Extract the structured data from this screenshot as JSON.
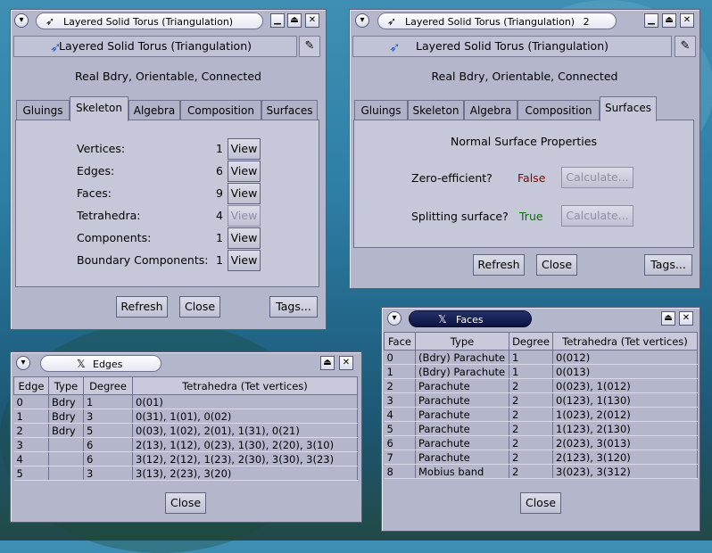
{
  "colors": {
    "false_color": "#8b0000",
    "true_color": "#0e6c0e",
    "accent": "#2a63c9"
  },
  "win1": {
    "title": "Layered Solid Torus (Triangulation)",
    "header": "Layered Solid Torus (Triangulation)",
    "status": "Real Bdry, Orientable, Connected",
    "tabs": [
      "Gluings",
      "Skeleton",
      "Algebra",
      "Composition",
      "Surfaces"
    ],
    "active_tab": "Skeleton",
    "rows": [
      {
        "label": "Vertices:",
        "count": "1",
        "button": "View",
        "enabled": true
      },
      {
        "label": "Edges:",
        "count": "6",
        "button": "View",
        "enabled": true
      },
      {
        "label": "Faces:",
        "count": "9",
        "button": "View",
        "enabled": true
      },
      {
        "label": "Tetrahedra:",
        "count": "4",
        "button": "View",
        "enabled": false
      },
      {
        "label": "Components:",
        "count": "1",
        "button": "View",
        "enabled": true
      },
      {
        "label": "Boundary Components:",
        "count": "1",
        "button": "View",
        "enabled": true
      }
    ],
    "refresh": "Refresh",
    "close": "Close",
    "tags": "Tags..."
  },
  "win2": {
    "title": "Layered Solid Torus (Triangulation)",
    "title_suffix": "2",
    "header": "Layered Solid Torus (Triangulation)",
    "status": "Real Bdry, Orientable, Connected",
    "tabs": [
      "Gluings",
      "Skeleton",
      "Algebra",
      "Composition",
      "Surfaces"
    ],
    "active_tab": "Surfaces",
    "section_title": "Normal Surface Properties",
    "props": [
      {
        "label": "Zero-efficient?",
        "value": "False",
        "button": "Calculate..."
      },
      {
        "label": "Splitting surface?",
        "value": "True",
        "button": "Calculate..."
      }
    ],
    "refresh": "Refresh",
    "close": "Close",
    "tags": "Tags..."
  },
  "edges": {
    "title": "Edges",
    "columns": [
      "Edge",
      "Type",
      "Degree",
      "Tetrahedra (Tet vertices)"
    ],
    "rows": [
      [
        "0",
        "Bdry",
        "1",
        "0(01)"
      ],
      [
        "1",
        "Bdry",
        "3",
        "0(31), 1(01), 0(02)"
      ],
      [
        "2",
        "Bdry",
        "5",
        "0(03), 1(02), 2(01), 1(31), 0(21)"
      ],
      [
        "3",
        "",
        "6",
        "2(13), 1(12), 0(23), 1(30), 2(20), 3(10)"
      ],
      [
        "4",
        "",
        "6",
        "3(12), 2(12), 1(23), 2(30), 3(30), 3(23)"
      ],
      [
        "5",
        "",
        "3",
        "3(13), 2(23), 3(20)"
      ]
    ],
    "close": "Close"
  },
  "faces": {
    "title": "Faces",
    "columns": [
      "Face",
      "Type",
      "Degree",
      "Tetrahedra (Tet vertices)"
    ],
    "rows": [
      [
        "0",
        "(Bdry) Parachute",
        "1",
        "0(012)"
      ],
      [
        "1",
        "(Bdry) Parachute",
        "1",
        "0(013)"
      ],
      [
        "2",
        "Parachute",
        "2",
        "0(023), 1(012)"
      ],
      [
        "3",
        "Parachute",
        "2",
        "0(123), 1(130)"
      ],
      [
        "4",
        "Parachute",
        "2",
        "1(023), 2(012)"
      ],
      [
        "5",
        "Parachute",
        "2",
        "1(123), 2(130)"
      ],
      [
        "6",
        "Parachute",
        "2",
        "2(023), 3(013)"
      ],
      [
        "7",
        "Parachute",
        "2",
        "2(123), 3(120)"
      ],
      [
        "8",
        "Mobius band",
        "2",
        "3(023), 3(312)"
      ]
    ],
    "close": "Close"
  },
  "icons": {
    "menu": "chevron-down-icon",
    "minimize": "minimize-icon",
    "maximize": "maximize-icon",
    "close": "close-icon",
    "app": "regina-bird-icon",
    "x": "x-logo-icon",
    "pin": "pin-icon"
  }
}
